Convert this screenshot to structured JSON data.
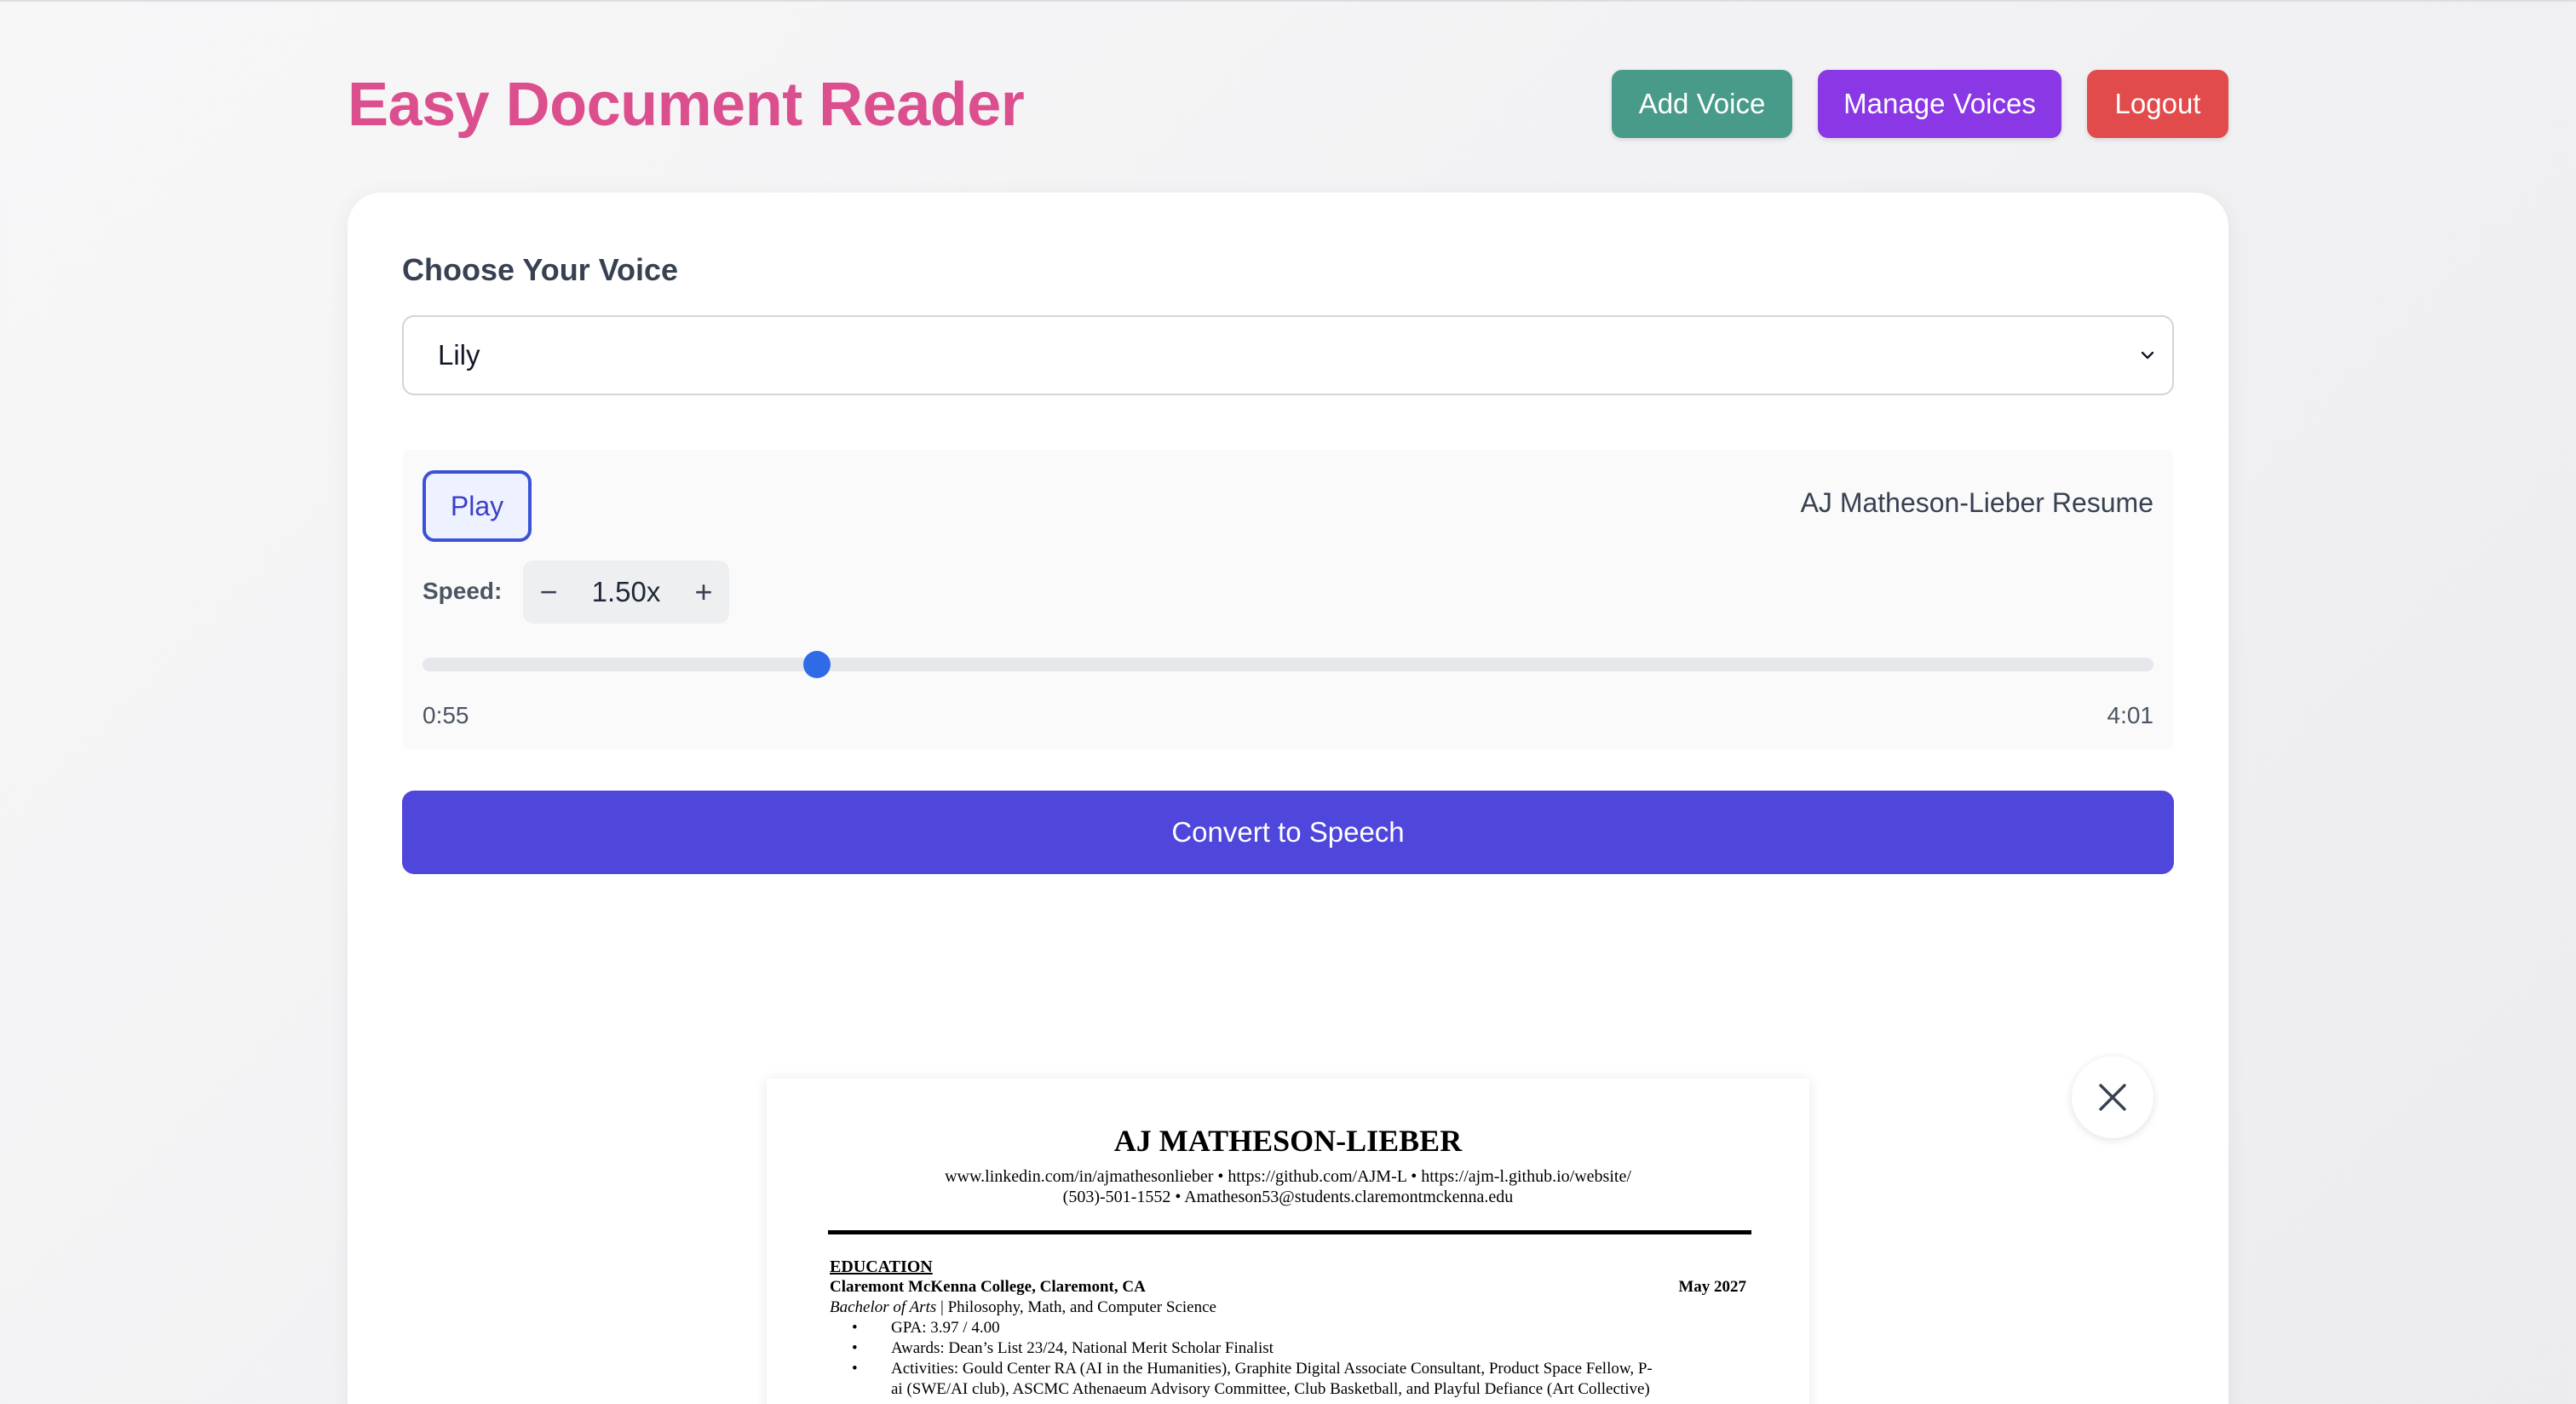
{
  "header": {
    "title": "Easy Document Reader",
    "buttons": {
      "add_voice": "Add Voice",
      "manage_voices": "Manage Voices",
      "logout": "Logout"
    },
    "colors": {
      "title": "#dc4f8e",
      "add_voice": "#479b88",
      "manage_voices": "#8a37e6",
      "logout": "#e24b4b"
    }
  },
  "voice": {
    "label": "Choose Your Voice",
    "selected": "Lily"
  },
  "player": {
    "play_label": "Play",
    "document_title": "AJ Matheson-Lieber Resume",
    "speed_label": "Speed:",
    "speed_value": "1.50x",
    "speed_decrement": "−",
    "speed_increment": "+",
    "current_time": "0:55",
    "total_time": "4:01",
    "progress_fraction": 0.228
  },
  "convert": {
    "label": "Convert to Speech",
    "color": "#4f46dc"
  },
  "document": {
    "name": "AJ MATHESON-LIEBER",
    "contact_line1": "www.linkedin.com/in/ajmathesonlieber •  https://github.com/AJM-L • https://ajm-l.github.io/website/",
    "contact_line2": "(503)-501-1552 • Amatheson53@students.claremontmckenna.edu",
    "section": "EDUCATION",
    "school": "Claremont McKenna College, Claremont, CA",
    "date": "May 2027",
    "degree_italic": "Bachelor of Arts",
    "degree_rest": " | Philosophy, Math, and Computer Science",
    "bullets": [
      "GPA: 3.97 / 4.00",
      "Awards: Dean’s List 23/24, National Merit Scholar Finalist",
      "Activities: Gould Center RA (AI in the Humanities), Graphite Digital Associate Consultant, Product Space Fellow, P-",
      "ai (SWE/AI club), ASCMC Athenaeum Advisory Committee, Club Basketball, and Playful Defiance (Art Collective)"
    ]
  }
}
